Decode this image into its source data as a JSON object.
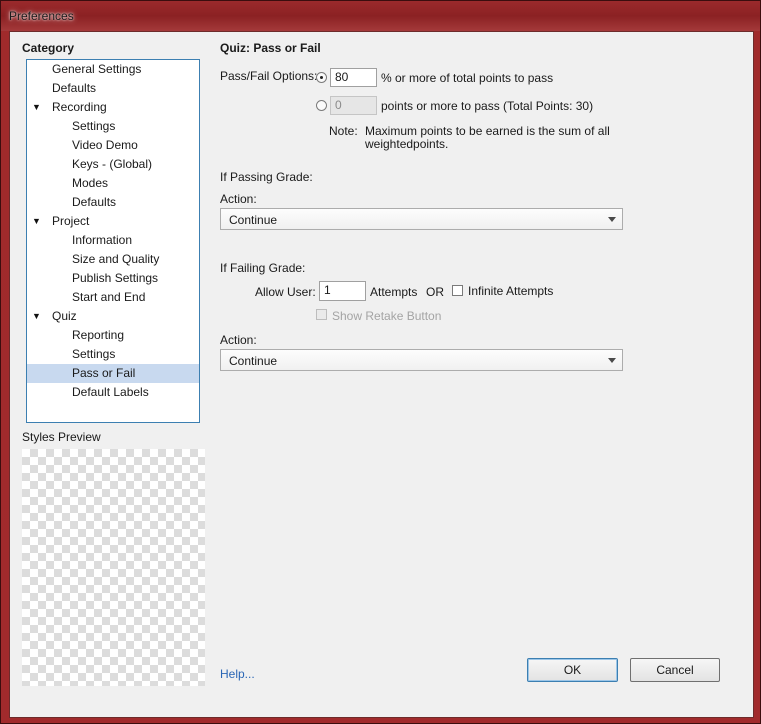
{
  "window": {
    "title": "Preferences"
  },
  "sidebar": {
    "heading": "Category",
    "items": [
      {
        "label": "General Settings",
        "level": 0,
        "arrow": ""
      },
      {
        "label": "Defaults",
        "level": 0,
        "arrow": ""
      },
      {
        "label": "Recording",
        "level": 0,
        "arrow": "▼"
      },
      {
        "label": "Settings",
        "level": 1,
        "arrow": ""
      },
      {
        "label": "Video Demo",
        "level": 1,
        "arrow": ""
      },
      {
        "label": "Keys - (Global)",
        "level": 1,
        "arrow": ""
      },
      {
        "label": "Modes",
        "level": 1,
        "arrow": ""
      },
      {
        "label": "Defaults",
        "level": 1,
        "arrow": ""
      },
      {
        "label": "Project",
        "level": 0,
        "arrow": "▼"
      },
      {
        "label": "Information",
        "level": 1,
        "arrow": ""
      },
      {
        "label": "Size and Quality",
        "level": 1,
        "arrow": ""
      },
      {
        "label": "Publish Settings",
        "level": 1,
        "arrow": ""
      },
      {
        "label": "Start and End",
        "level": 1,
        "arrow": ""
      },
      {
        "label": "Quiz",
        "level": 0,
        "arrow": "▼"
      },
      {
        "label": "Reporting",
        "level": 1,
        "arrow": ""
      },
      {
        "label": "Settings",
        "level": 1,
        "arrow": ""
      },
      {
        "label": "Pass or Fail",
        "level": 1,
        "arrow": "",
        "selected": true
      },
      {
        "label": "Default Labels",
        "level": 1,
        "arrow": ""
      }
    ],
    "styles_preview_label": "Styles Preview"
  },
  "main": {
    "title": "Quiz: Pass or Fail",
    "pass_fail_label": "Pass/Fail Options:",
    "percent_value": "80",
    "percent_text": "% or more of total points to pass",
    "points_value": "0",
    "points_text": "points or more to pass (Total Points: 30)",
    "note_label": "Note:",
    "note_line1": "Maximum points to be earned is the sum of all",
    "note_line2": "weightedpoints.",
    "passing_heading": "If Passing Grade:",
    "passing_action_label": "Action:",
    "passing_action_value": "Continue",
    "failing_heading": "If Failing Grade:",
    "allow_user_label": "Allow User:",
    "attempts_value": "1",
    "attempts_text": "Attempts",
    "or_text": "OR",
    "infinite_attempts_label": "Infinite Attempts",
    "show_retake_label": "Show Retake Button",
    "failing_action_label": "Action:",
    "failing_action_value": "Continue"
  },
  "footer": {
    "help_label": "Help...",
    "ok_label": "OK",
    "cancel_label": "Cancel"
  }
}
